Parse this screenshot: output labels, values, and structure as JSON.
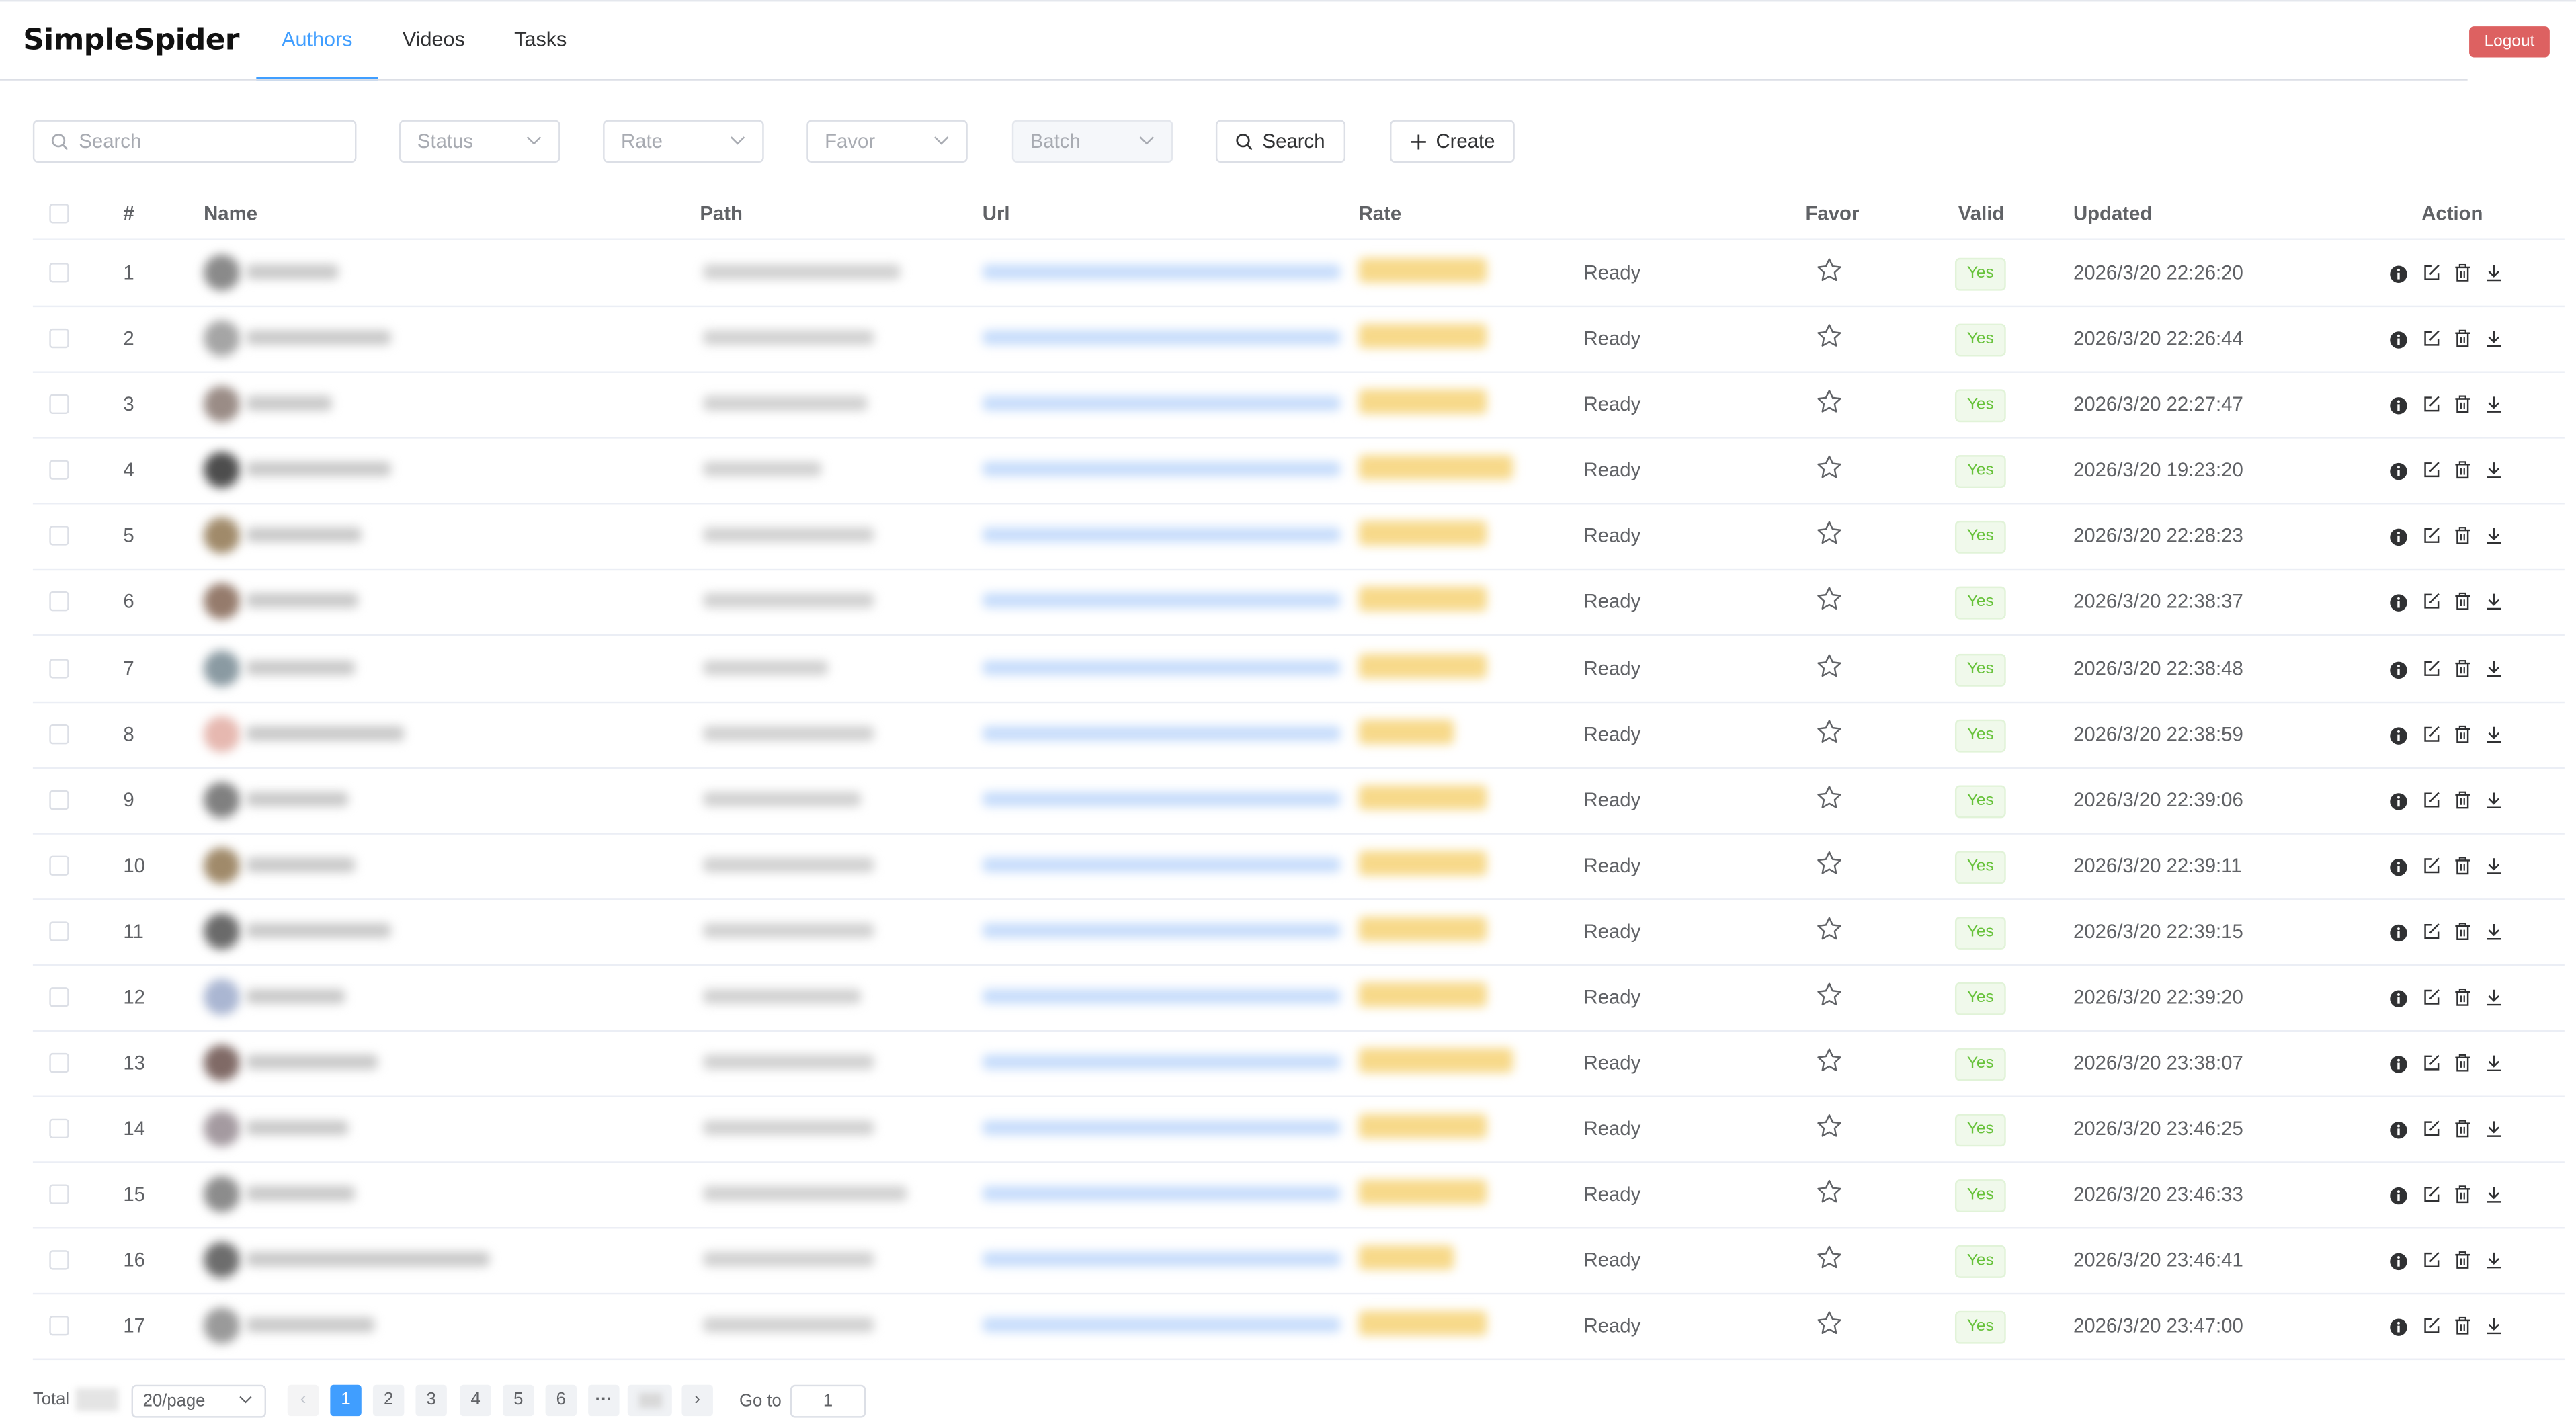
{
  "app": {
    "title": "SimpleSpider"
  },
  "nav": {
    "tabs": [
      {
        "label": "Authors"
      },
      {
        "label": "Videos"
      },
      {
        "label": "Tasks"
      }
    ],
    "logout": "Logout"
  },
  "filters": {
    "search_placeholder": "Search",
    "status_placeholder": "Status",
    "rate_placeholder": "Rate",
    "favor_placeholder": "Favor",
    "batch_placeholder": "Batch",
    "search_button": "Search",
    "create_button": "Create"
  },
  "table": {
    "headers": {
      "index": "#",
      "name": "Name",
      "path": "Path",
      "url": "Url",
      "rate": "Rate",
      "favor": "Favor",
      "valid": "Valid",
      "updated": "Updated",
      "action": "Action"
    },
    "rows": [
      {
        "index": "1",
        "status": "Ready",
        "valid": "Yes",
        "updated": "2026/3/20 22:26:20"
      },
      {
        "index": "2",
        "status": "Ready",
        "valid": "Yes",
        "updated": "2026/3/20 22:26:44"
      },
      {
        "index": "3",
        "status": "Ready",
        "valid": "Yes",
        "updated": "2026/3/20 22:27:47"
      },
      {
        "index": "4",
        "status": "Ready",
        "valid": "Yes",
        "updated": "2026/3/20 19:23:20"
      },
      {
        "index": "5",
        "status": "Ready",
        "valid": "Yes",
        "updated": "2026/3/20 22:28:23"
      },
      {
        "index": "6",
        "status": "Ready",
        "valid": "Yes",
        "updated": "2026/3/20 22:38:37"
      },
      {
        "index": "7",
        "status": "Ready",
        "valid": "Yes",
        "updated": "2026/3/20 22:38:48"
      },
      {
        "index": "8",
        "status": "Ready",
        "valid": "Yes",
        "updated": "2026/3/20 22:38:59"
      },
      {
        "index": "9",
        "status": "Ready",
        "valid": "Yes",
        "updated": "2026/3/20 22:39:06"
      },
      {
        "index": "10",
        "status": "Ready",
        "valid": "Yes",
        "updated": "2026/3/20 22:39:11"
      },
      {
        "index": "11",
        "status": "Ready",
        "valid": "Yes",
        "updated": "2026/3/20 22:39:15"
      },
      {
        "index": "12",
        "status": "Ready",
        "valid": "Yes",
        "updated": "2026/3/20 22:39:20"
      },
      {
        "index": "13",
        "status": "Ready",
        "valid": "Yes",
        "updated": "2026/3/20 23:38:07"
      },
      {
        "index": "14",
        "status": "Ready",
        "valid": "Yes",
        "updated": "2026/3/20 23:46:25"
      },
      {
        "index": "15",
        "status": "Ready",
        "valid": "Yes",
        "updated": "2026/3/20 23:46:33"
      },
      {
        "index": "16",
        "status": "Ready",
        "valid": "Yes",
        "updated": "2026/3/20 23:46:41"
      },
      {
        "index": "17",
        "status": "Ready",
        "valid": "Yes",
        "updated": "2026/3/20 23:47:00"
      }
    ],
    "action_icons": [
      "info-icon",
      "edit-icon",
      "delete-icon",
      "download-icon"
    ]
  },
  "pagination": {
    "total_label": "Total",
    "page_size": "20/page",
    "pages": [
      "1",
      "2",
      "3",
      "4",
      "5",
      "6"
    ],
    "current_page": "1",
    "goto_label": "Go to",
    "goto_value": "1"
  },
  "colors": {
    "accent": "#409eff",
    "danger": "#dd6161",
    "success": "#67c23a",
    "rate": "#f7d98a",
    "url": "#c6dcfb"
  }
}
